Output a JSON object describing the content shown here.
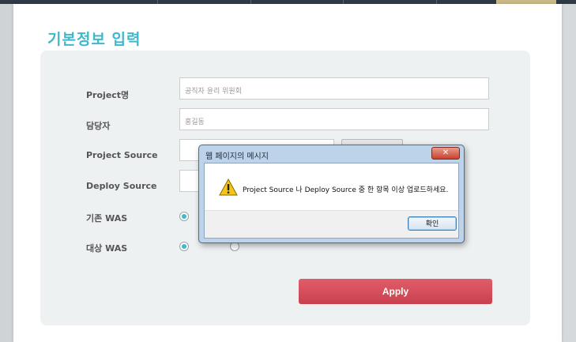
{
  "page_title": "기본정보 입력",
  "form": {
    "project_name_label": "Project명",
    "project_name_value": "공직자 윤리 위원회",
    "manager_label": "담당자",
    "manager_value": "홍길동",
    "project_source_label": "Project Source",
    "deploy_source_label": "Deploy Source",
    "existing_was_label": "기존 WAS",
    "target_was_label": "대상 WAS",
    "apply_label": "Apply"
  },
  "dialog": {
    "title": "웹 페이지의 메시지",
    "close_glyph": "✕",
    "message": "Project Source 나 Deploy Source 중 한 항목 이상 업로드하세요.",
    "ok_label": "확인"
  },
  "colors": {
    "accent": "#3fb8c9",
    "apply_button": "#d54f5c",
    "dialog_frame": "#bcd3ea"
  }
}
